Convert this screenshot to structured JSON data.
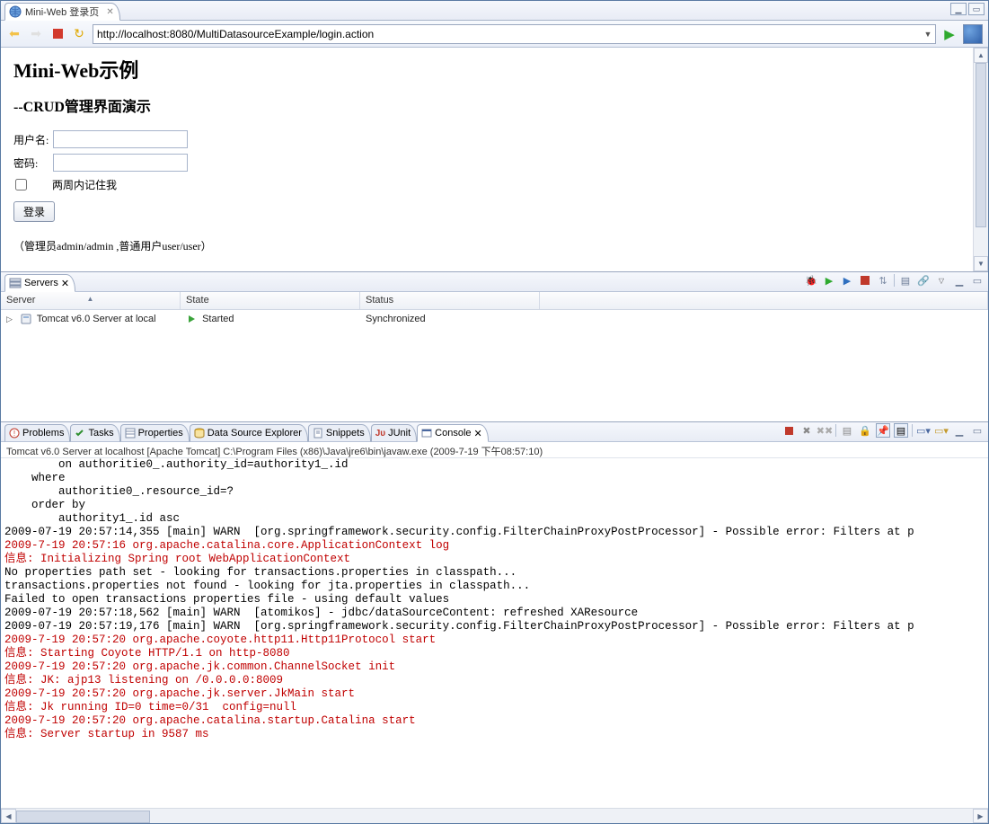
{
  "tab": {
    "title": "Mini-Web 登录页"
  },
  "browser": {
    "url": "http://localhost:8080/MultiDatasourceExample/login.action"
  },
  "page": {
    "h1": "Mini-Web示例",
    "h2": "--CRUD管理界面演示",
    "labels": {
      "username": "用户名:",
      "password": "密码:",
      "remember": "两周内记住我"
    },
    "login_btn": "登录",
    "hint": "（管理员admin/admin ,普通用户user/user）"
  },
  "servers_view": {
    "tab_label": "Servers",
    "columns": {
      "server": "Server",
      "state": "State",
      "status": "Status"
    },
    "rows": [
      {
        "name": "Tomcat v6.0 Server at local",
        "state": "Started",
        "status": "Synchronized"
      }
    ]
  },
  "bottom_tabs": {
    "items": [
      {
        "label": "Problems"
      },
      {
        "label": "Tasks"
      },
      {
        "label": "Properties"
      },
      {
        "label": "Data Source Explorer"
      },
      {
        "label": "Snippets"
      },
      {
        "label": "JUnit"
      },
      {
        "label": "Console",
        "active": true
      }
    ]
  },
  "console": {
    "desc": "Tomcat v6.0 Server at localhost [Apache Tomcat] C:\\Program Files (x86)\\Java\\jre6\\bin\\javaw.exe (2009-7-19 下午08:57:10)",
    "lines": [
      {
        "c": "black",
        "t": "        on authoritie0_.authority_id=authority1_.id"
      },
      {
        "c": "black",
        "t": "    where"
      },
      {
        "c": "black",
        "t": "        authoritie0_.resource_id=?"
      },
      {
        "c": "black",
        "t": "    order by"
      },
      {
        "c": "black",
        "t": "        authority1_.id asc"
      },
      {
        "c": "black",
        "t": "2009-07-19 20:57:14,355 [main] WARN  [org.springframework.security.config.FilterChainProxyPostProcessor] - Possible error: Filters at p"
      },
      {
        "c": "red",
        "t": "2009-7-19 20:57:16 org.apache.catalina.core.ApplicationContext log"
      },
      {
        "c": "red",
        "t": "信息: Initializing Spring root WebApplicationContext"
      },
      {
        "c": "black",
        "t": "No properties path set - looking for transactions.properties in classpath..."
      },
      {
        "c": "black",
        "t": "transactions.properties not found - looking for jta.properties in classpath..."
      },
      {
        "c": "black",
        "t": "Failed to open transactions properties file - using default values"
      },
      {
        "c": "black",
        "t": "2009-07-19 20:57:18,562 [main] WARN  [atomikos] - jdbc/dataSourceContent: refreshed XAResource"
      },
      {
        "c": "black",
        "t": "2009-07-19 20:57:19,176 [main] WARN  [org.springframework.security.config.FilterChainProxyPostProcessor] - Possible error: Filters at p"
      },
      {
        "c": "red",
        "t": "2009-7-19 20:57:20 org.apache.coyote.http11.Http11Protocol start"
      },
      {
        "c": "red",
        "t": "信息: Starting Coyote HTTP/1.1 on http-8080"
      },
      {
        "c": "red",
        "t": "2009-7-19 20:57:20 org.apache.jk.common.ChannelSocket init"
      },
      {
        "c": "red",
        "t": "信息: JK: ajp13 listening on /0.0.0.0:8009"
      },
      {
        "c": "red",
        "t": "2009-7-19 20:57:20 org.apache.jk.server.JkMain start"
      },
      {
        "c": "red",
        "t": "信息: Jk running ID=0 time=0/31  config=null"
      },
      {
        "c": "red",
        "t": "2009-7-19 20:57:20 org.apache.catalina.startup.Catalina start"
      },
      {
        "c": "red",
        "t": "信息: Server startup in 9587 ms"
      }
    ]
  }
}
